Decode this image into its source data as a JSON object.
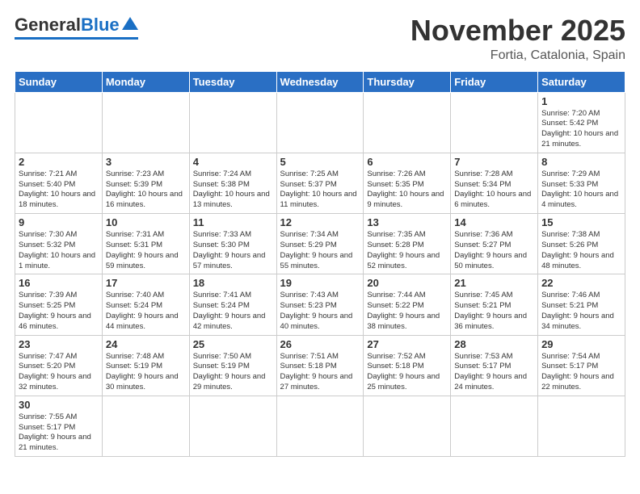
{
  "logo": {
    "general": "General",
    "blue": "Blue"
  },
  "header": {
    "month": "November 2025",
    "location": "Fortia, Catalonia, Spain"
  },
  "weekdays": [
    "Sunday",
    "Monday",
    "Tuesday",
    "Wednesday",
    "Thursday",
    "Friday",
    "Saturday"
  ],
  "weeks": [
    [
      {
        "day": "",
        "info": ""
      },
      {
        "day": "",
        "info": ""
      },
      {
        "day": "",
        "info": ""
      },
      {
        "day": "",
        "info": ""
      },
      {
        "day": "",
        "info": ""
      },
      {
        "day": "",
        "info": ""
      },
      {
        "day": "1",
        "info": "Sunrise: 7:20 AM\nSunset: 5:42 PM\nDaylight: 10 hours\nand 21 minutes."
      }
    ],
    [
      {
        "day": "2",
        "info": "Sunrise: 7:21 AM\nSunset: 5:40 PM\nDaylight: 10 hours\nand 18 minutes."
      },
      {
        "day": "3",
        "info": "Sunrise: 7:23 AM\nSunset: 5:39 PM\nDaylight: 10 hours\nand 16 minutes."
      },
      {
        "day": "4",
        "info": "Sunrise: 7:24 AM\nSunset: 5:38 PM\nDaylight: 10 hours\nand 13 minutes."
      },
      {
        "day": "5",
        "info": "Sunrise: 7:25 AM\nSunset: 5:37 PM\nDaylight: 10 hours\nand 11 minutes."
      },
      {
        "day": "6",
        "info": "Sunrise: 7:26 AM\nSunset: 5:35 PM\nDaylight: 10 hours\nand 9 minutes."
      },
      {
        "day": "7",
        "info": "Sunrise: 7:28 AM\nSunset: 5:34 PM\nDaylight: 10 hours\nand 6 minutes."
      },
      {
        "day": "8",
        "info": "Sunrise: 7:29 AM\nSunset: 5:33 PM\nDaylight: 10 hours\nand 4 minutes."
      }
    ],
    [
      {
        "day": "9",
        "info": "Sunrise: 7:30 AM\nSunset: 5:32 PM\nDaylight: 10 hours\nand 1 minute."
      },
      {
        "day": "10",
        "info": "Sunrise: 7:31 AM\nSunset: 5:31 PM\nDaylight: 9 hours\nand 59 minutes."
      },
      {
        "day": "11",
        "info": "Sunrise: 7:33 AM\nSunset: 5:30 PM\nDaylight: 9 hours\nand 57 minutes."
      },
      {
        "day": "12",
        "info": "Sunrise: 7:34 AM\nSunset: 5:29 PM\nDaylight: 9 hours\nand 55 minutes."
      },
      {
        "day": "13",
        "info": "Sunrise: 7:35 AM\nSunset: 5:28 PM\nDaylight: 9 hours\nand 52 minutes."
      },
      {
        "day": "14",
        "info": "Sunrise: 7:36 AM\nSunset: 5:27 PM\nDaylight: 9 hours\nand 50 minutes."
      },
      {
        "day": "15",
        "info": "Sunrise: 7:38 AM\nSunset: 5:26 PM\nDaylight: 9 hours\nand 48 minutes."
      }
    ],
    [
      {
        "day": "16",
        "info": "Sunrise: 7:39 AM\nSunset: 5:25 PM\nDaylight: 9 hours\nand 46 minutes."
      },
      {
        "day": "17",
        "info": "Sunrise: 7:40 AM\nSunset: 5:24 PM\nDaylight: 9 hours\nand 44 minutes."
      },
      {
        "day": "18",
        "info": "Sunrise: 7:41 AM\nSunset: 5:24 PM\nDaylight: 9 hours\nand 42 minutes."
      },
      {
        "day": "19",
        "info": "Sunrise: 7:43 AM\nSunset: 5:23 PM\nDaylight: 9 hours\nand 40 minutes."
      },
      {
        "day": "20",
        "info": "Sunrise: 7:44 AM\nSunset: 5:22 PM\nDaylight: 9 hours\nand 38 minutes."
      },
      {
        "day": "21",
        "info": "Sunrise: 7:45 AM\nSunset: 5:21 PM\nDaylight: 9 hours\nand 36 minutes."
      },
      {
        "day": "22",
        "info": "Sunrise: 7:46 AM\nSunset: 5:21 PM\nDaylight: 9 hours\nand 34 minutes."
      }
    ],
    [
      {
        "day": "23",
        "info": "Sunrise: 7:47 AM\nSunset: 5:20 PM\nDaylight: 9 hours\nand 32 minutes."
      },
      {
        "day": "24",
        "info": "Sunrise: 7:48 AM\nSunset: 5:19 PM\nDaylight: 9 hours\nand 30 minutes."
      },
      {
        "day": "25",
        "info": "Sunrise: 7:50 AM\nSunset: 5:19 PM\nDaylight: 9 hours\nand 29 minutes."
      },
      {
        "day": "26",
        "info": "Sunrise: 7:51 AM\nSunset: 5:18 PM\nDaylight: 9 hours\nand 27 minutes."
      },
      {
        "day": "27",
        "info": "Sunrise: 7:52 AM\nSunset: 5:18 PM\nDaylight: 9 hours\nand 25 minutes."
      },
      {
        "day": "28",
        "info": "Sunrise: 7:53 AM\nSunset: 5:17 PM\nDaylight: 9 hours\nand 24 minutes."
      },
      {
        "day": "29",
        "info": "Sunrise: 7:54 AM\nSunset: 5:17 PM\nDaylight: 9 hours\nand 22 minutes."
      }
    ],
    [
      {
        "day": "30",
        "info": "Sunrise: 7:55 AM\nSunset: 5:17 PM\nDaylight: 9 hours\nand 21 minutes."
      },
      {
        "day": "",
        "info": ""
      },
      {
        "day": "",
        "info": ""
      },
      {
        "day": "",
        "info": ""
      },
      {
        "day": "",
        "info": ""
      },
      {
        "day": "",
        "info": ""
      },
      {
        "day": "",
        "info": ""
      }
    ]
  ]
}
